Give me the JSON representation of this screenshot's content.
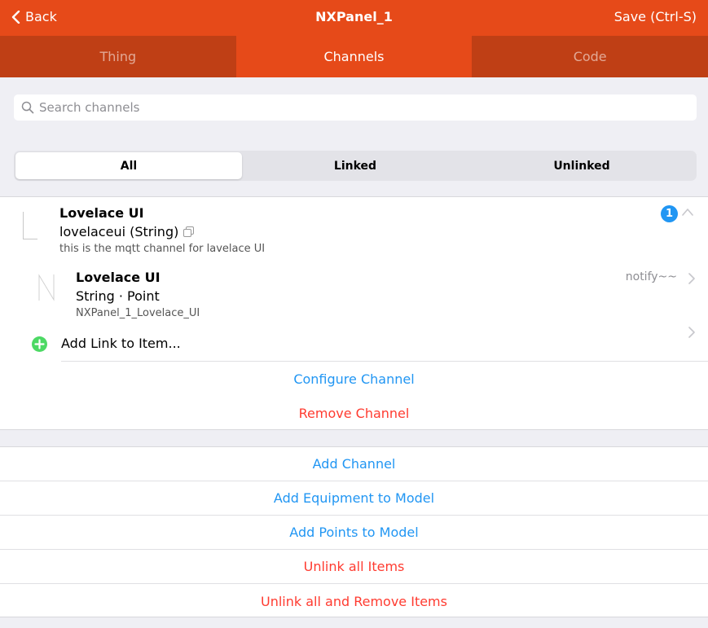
{
  "navbar": {
    "back_label": "Back",
    "title": "NXPanel_1",
    "save_label": "Save (Ctrl-S)"
  },
  "tabs": [
    {
      "label": "Thing",
      "active": false
    },
    {
      "label": "Channels",
      "active": true
    },
    {
      "label": "Code",
      "active": false
    }
  ],
  "search": {
    "placeholder": "Search channels",
    "value": ""
  },
  "filter": {
    "options": [
      "All",
      "Linked",
      "Unlinked"
    ],
    "selected": "All"
  },
  "channel": {
    "label": "Lovelace UI",
    "id_type": "lovelaceui (String)",
    "description": "this is the mqtt channel for lavelace UI",
    "link_count": "1",
    "type_glyph": "L",
    "linked_item": {
      "label": "Lovelace UI",
      "type_semantics": "String · Point",
      "name": "NXPanel_1_Lovelace_UI",
      "state": "notify~~",
      "type_glyph": "N"
    },
    "add_link_label": "Add Link to Item...",
    "configure_label": "Configure Channel",
    "remove_label": "Remove Channel"
  },
  "actions": {
    "add_channel": "Add Channel",
    "add_equipment": "Add Equipment to Model",
    "add_points": "Add Points to Model",
    "unlink_all": "Unlink all Items",
    "unlink_remove": "Unlink all and Remove Items"
  },
  "colors": {
    "primary": "#e64a19",
    "tab_inactive_bg": "#bf3f15",
    "link_blue": "#2196f3",
    "destructive_red": "#ff3b30",
    "add_green": "#4cd964",
    "badge_blue": "#2196f3"
  }
}
